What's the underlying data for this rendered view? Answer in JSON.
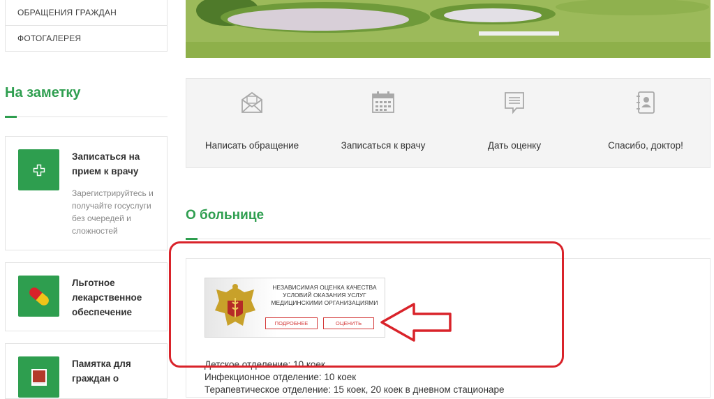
{
  "sidebar": {
    "menu": [
      {
        "label": "ОБРАЩЕНИЯ ГРАЖДАН"
      },
      {
        "label": "ФОТОГАЛЕРЕЯ"
      }
    ],
    "heading": "На заметку",
    "cards": [
      {
        "title": "Записаться на прием к врачу",
        "desc": "Зарегистрируйтесь и получайте госуслуги без очередей и сложностей",
        "icon": "medical-cross-icon"
      },
      {
        "title": "Льготное лекарственное обеспечение",
        "desc": "",
        "icon": "pill-icon"
      },
      {
        "title": "Памятка для граждан о",
        "desc": "",
        "icon": "book-icon"
      }
    ]
  },
  "services": [
    {
      "label": "Написать обращение",
      "icon": "envelope-icon"
    },
    {
      "label": "Записаться к врачу",
      "icon": "calendar-icon"
    },
    {
      "label": "Дать оценку",
      "icon": "message-icon"
    },
    {
      "label": "Спасибо, доктор!",
      "icon": "contact-card-icon"
    }
  ],
  "about": {
    "heading": "О больнице",
    "banner": {
      "text": "НЕЗАВИСИМАЯ ОЦЕНКА КАЧЕСТВА УСЛОВИЙ ОКАЗАНИЯ УСЛУГ МЕДИЦИНСКИМИ ОРГАНИЗАЦИЯМИ",
      "more_label": "ПОДРОБНЕЕ",
      "rate_label": "ОЦЕНИТЬ",
      "emblem": "ministry-emblem-icon"
    },
    "lines": [
      "Детское отделение: 10 коек",
      "Инфекционное отделение: 10 коек",
      "Терапевтическое отделение: 15 коек, 20 коек в дневном стационаре"
    ]
  },
  "colors": {
    "accent": "#2e9e4f",
    "annotation": "#d9232a"
  }
}
